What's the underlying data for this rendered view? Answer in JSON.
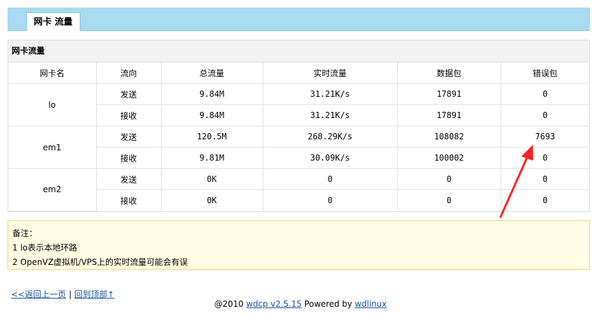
{
  "header": {
    "tab_label": "网卡 流量"
  },
  "panel": {
    "title": "网卡流量",
    "columns": [
      "网卡名",
      "流向",
      "总流量",
      "实时流量",
      "数据包",
      "错误包"
    ],
    "interfaces": [
      {
        "name": "lo",
        "rows": [
          {
            "direction": "发送",
            "total": "9.84M",
            "rate": "31.21K/s",
            "packets": "17891",
            "errors": "0"
          },
          {
            "direction": "接收",
            "total": "9.84M",
            "rate": "31.21K/s",
            "packets": "17891",
            "errors": "0"
          }
        ]
      },
      {
        "name": "em1",
        "rows": [
          {
            "direction": "发送",
            "total": "120.5M",
            "rate": "268.29K/s",
            "packets": "108082",
            "errors": "7693"
          },
          {
            "direction": "接收",
            "total": "9.81M",
            "rate": "30.09K/s",
            "packets": "100002",
            "errors": "0"
          }
        ]
      },
      {
        "name": "em2",
        "rows": [
          {
            "direction": "发送",
            "total": "0K",
            "rate": "0",
            "packets": "0",
            "errors": "0"
          },
          {
            "direction": "接收",
            "total": "0K",
            "rate": "0",
            "packets": "0",
            "errors": "0"
          }
        ]
      }
    ]
  },
  "note": {
    "title": "备注：",
    "lines": [
      "1 lo表示本地环路",
      "2 OpenVZ虚拟机/VPS上的实时流量可能会有误"
    ]
  },
  "nav": {
    "back_label": "<<返回上一页",
    "separator": "|",
    "top_label": "回到顶部↑"
  },
  "footer": {
    "prefix": "@2010 ",
    "product_link": "wdcp v2.5.15",
    "middle": " Powered by ",
    "brand_link": "wdlinux"
  },
  "annotation": {
    "arrow_color": "#ff2020"
  }
}
